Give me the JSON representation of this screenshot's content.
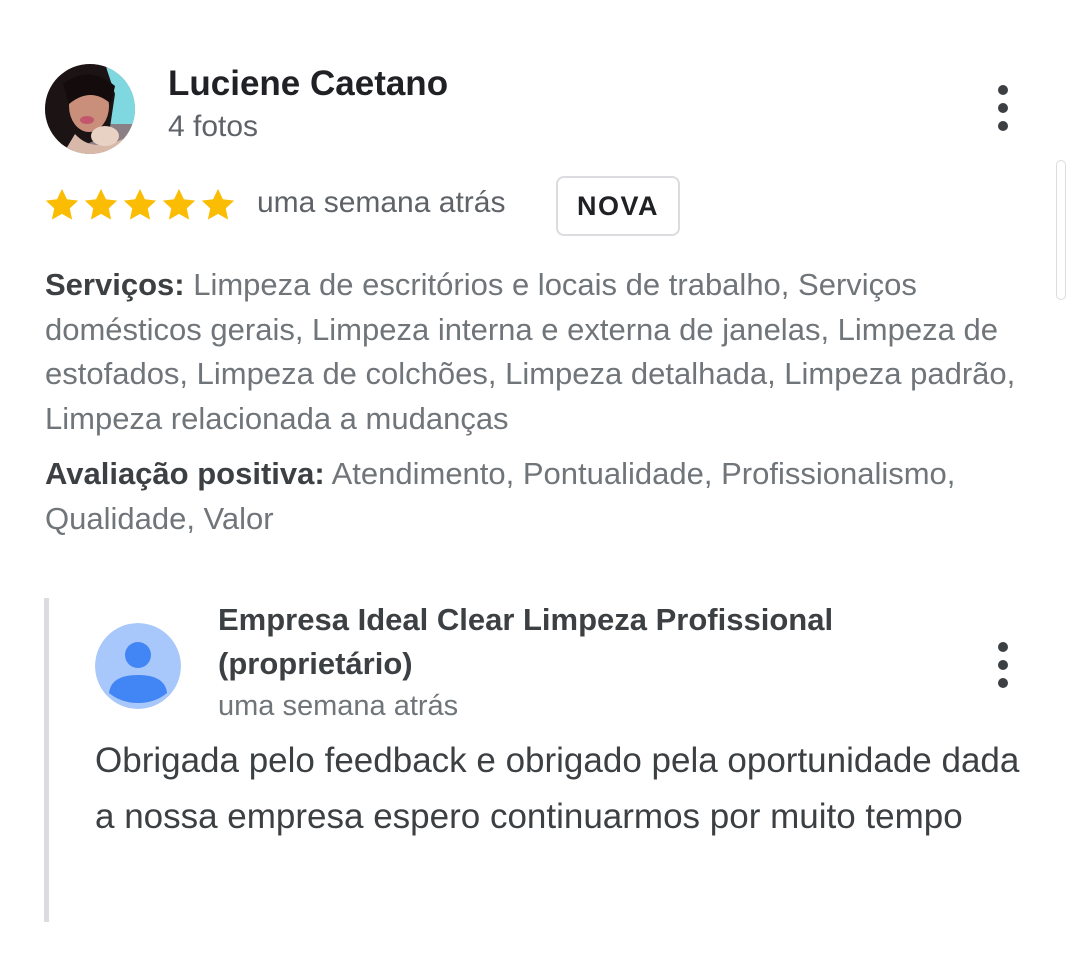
{
  "review": {
    "reviewer_name": "Luciene Caetano",
    "reviewer_sub": "4 fotos",
    "rating": 5,
    "rating_max": 5,
    "date": "uma semana atrás",
    "badge": "NOVA",
    "services_label": "Serviços:",
    "services_value": "Limpeza de escritórios e locais de trabalho, Serviços domésticos gerais, Limpeza interna e externa de janelas, Limpeza de estofados, Limpeza de colchões, Limpeza detalhada, Limpeza padrão, Limpeza relacionada a mudanças",
    "positive_label": "Avaliação positiva:",
    "positive_value": "Atendimento, Pontualidade, Profissionalismo, Qualidade, Valor"
  },
  "reply": {
    "owner_name": "Empresa Ideal Clear Limpeza Profissional (proprietário)",
    "date": "uma semana atrás",
    "text": "Obrigada pelo feedback e obrigado pela oportunidade dada a nossa empresa espero continuarmos por muito tempo"
  },
  "icons": {
    "star": "star-icon",
    "more": "more-vert-icon",
    "owner_avatar": "person-icon"
  },
  "colors": {
    "star": "#fbbc04",
    "owner_avatar_bg": "#a8c7fa",
    "owner_avatar_fg": "#4285f4",
    "secondary_text": "#70757a",
    "primary_text": "#202124"
  }
}
